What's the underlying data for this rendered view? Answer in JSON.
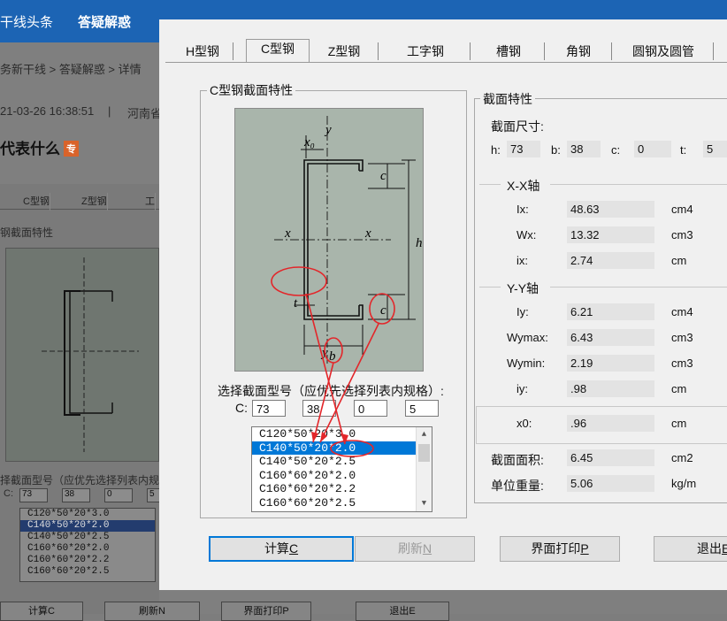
{
  "background": {
    "nav": [
      {
        "label": "干线头条",
        "x": 0,
        "active": false
      },
      {
        "label": "答疑解惑",
        "x": 88,
        "active": true
      }
    ],
    "breadcrumb": "务新干线 > 答疑解惑 > 详情",
    "datetime": "21-03-26 16:38:51",
    "separator": "|",
    "location": "河南省",
    "title": "代表什么",
    "badge": "专",
    "old_tabs": [
      "C型钢",
      "Z型钢",
      "工"
    ],
    "old_group": "钢截面特性",
    "old_select_label": "择截面型号（应优先选择列表内规",
    "old_c_label": "C:",
    "old_fields": [
      "73",
      "38",
      "0",
      "5"
    ],
    "old_list": [
      "C120*50*20*3.0",
      "C140*50*20*2.0",
      "C140*50*20*2.5",
      "C160*60*20*2.0",
      "C160*60*20*2.2",
      "C160*60*20*2.5"
    ],
    "old_buttons": [
      "计算C",
      "刷新N",
      "界面打印P",
      "退出E"
    ]
  },
  "dialog": {
    "tabs": [
      "H型钢",
      "C型钢",
      "Z型钢",
      "工字钢",
      "槽钢",
      "角钢",
      "圆钢及圆管"
    ],
    "active_tab": "C型钢",
    "left_group_title": "C型钢截面特性",
    "diagram": {
      "x0": "x₀",
      "y_top": "y",
      "y_bottom": "y",
      "x_left": "x",
      "x_right": "x",
      "c_top": "c",
      "c_bottom": "c",
      "h": "h",
      "t": "t",
      "b": "b"
    },
    "select_label": "选择截面型号（应优先选择列表内规格）:",
    "c_label": "C:",
    "inputs": [
      "73",
      "38",
      "0",
      "5"
    ],
    "list_items": [
      "C120*50*20*3.0",
      "C140*50*20*2.0",
      "C140*50*20*2.5",
      "C160*60*20*2.0",
      "C160*60*20*2.2",
      "C160*60*20*2.5"
    ],
    "selected_index": 1,
    "right_group_title": "截面特性",
    "dims_label": "截面尺寸:",
    "dims": [
      {
        "label": "h:",
        "value": "73"
      },
      {
        "label": "b:",
        "value": "38"
      },
      {
        "label": "c:",
        "value": "0"
      },
      {
        "label": "t:",
        "value": "5"
      }
    ],
    "xx_label": "X-X轴",
    "xx": [
      {
        "label": "Ix:",
        "value": "48.63",
        "unit": "cm4"
      },
      {
        "label": "Wx:",
        "value": "13.32",
        "unit": "cm3"
      },
      {
        "label": "ix:",
        "value": "2.74",
        "unit": "cm"
      }
    ],
    "yy_label": "Y-Y轴",
    "yy": [
      {
        "label": "Iy:",
        "value": "6.21",
        "unit": "cm4"
      },
      {
        "label": "Wymax:",
        "value": "6.43",
        "unit": "cm3"
      },
      {
        "label": "Wymin:",
        "value": "2.19",
        "unit": "cm3"
      },
      {
        "label": "iy:",
        "value": ".98",
        "unit": "cm"
      }
    ],
    "x0": {
      "label": "x0:",
      "value": ".96",
      "unit": "cm"
    },
    "area": {
      "label": "截面面积:",
      "value": "6.45",
      "unit": "cm2"
    },
    "weight": {
      "label": "单位重量:",
      "value": "5.06",
      "unit": "kg/m"
    },
    "buttons": {
      "calc": "计算",
      "calc_key": "C",
      "refresh": "刷新",
      "refresh_key": "N",
      "print": "界面打印",
      "print_key": "P",
      "exit": "退出",
      "exit_key": "E"
    }
  },
  "colors": {
    "annotation": "#e3262a",
    "selection": "#0078d7",
    "diagram_bg": "#a9b5ab"
  }
}
